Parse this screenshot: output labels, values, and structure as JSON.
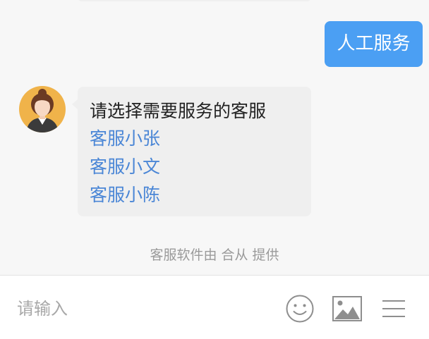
{
  "chat": {
    "user_message": "人工服务",
    "agent_message": {
      "title": "请选择需要服务的客服",
      "options": [
        "客服小张",
        "客服小文",
        "客服小陈"
      ]
    },
    "footer_note": "客服软件由 合从 提供"
  },
  "composer": {
    "placeholder": "请输入",
    "icons": [
      "emoji-icon",
      "image-icon",
      "menu-icon"
    ]
  },
  "colors": {
    "accent": "#4b9ff3",
    "link": "#4a86d6",
    "avatar_bg": "#f0b34a"
  }
}
